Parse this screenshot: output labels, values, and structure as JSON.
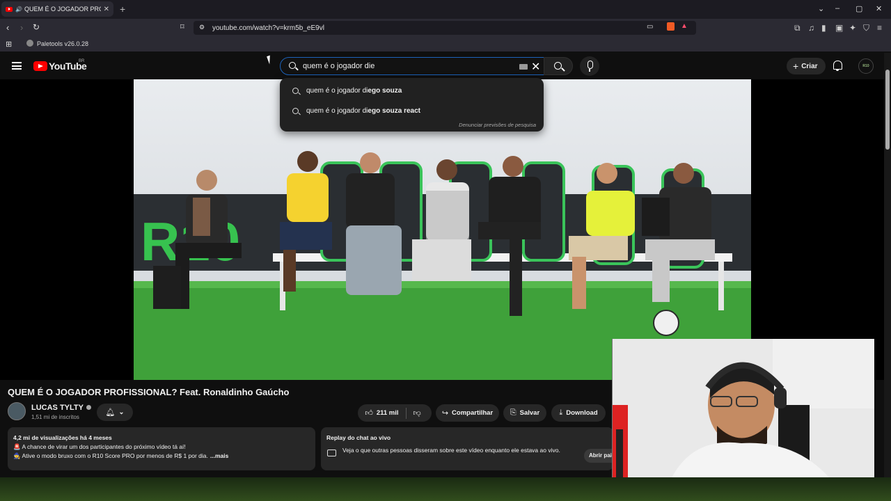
{
  "browser": {
    "tab_title": "QUEM É O JOGADOR PROFISSIONAL?",
    "tab_close": "✕",
    "new_tab": "+",
    "url": "youtube.com/watch?v=krm5b_eE9vl",
    "bookmark_label": "Paletools v26.0.28"
  },
  "youtube": {
    "logo_text": "YouTube",
    "region": "BR",
    "search_query": "quem é o jogador die",
    "suggestions": [
      {
        "prefix": "quem é o jogador di",
        "bold": "ego souza"
      },
      {
        "prefix": "quem é o jogador di",
        "bold": "ego souza react"
      }
    ],
    "report_text": "Denunciar previsões de pesquisa",
    "create_label": "Criar",
    "avatar_text": "R10"
  },
  "video": {
    "title": "QUEM É O JOGADOR PROFISSIONAL? Feat. Ronaldinho Gaúcho",
    "channel_name": "LUCAS TYLTY",
    "subscribers": "1,51 mi de inscritos",
    "likes": "211 mil",
    "share_label": "Compartilhar",
    "save_label": "Salvar",
    "download_label": "Download",
    "views_meta": "4,2 mi de visualizações  há 4 meses",
    "desc_line1": "🚨 A chance de virar um dos participantes do próximo vídeo tá aí!",
    "desc_line2": "🧙 Ative o modo bruxo com o R10 Score PRO por menos de R$ 1 por dia.",
    "more_label": "...mais",
    "chat_title": "Replay do chat ao vivo",
    "chat_text": "Veja o que outras pessoas disseram sobre este vídeo enquanto ele estava ao vivo.",
    "chat_button": "Abrir pain",
    "scene_brand": "R10"
  },
  "colors": {
    "accent_red": "#ff0000",
    "search_border": "#1c62b9",
    "bg": "#0f0f0f",
    "pill": "#272727"
  }
}
